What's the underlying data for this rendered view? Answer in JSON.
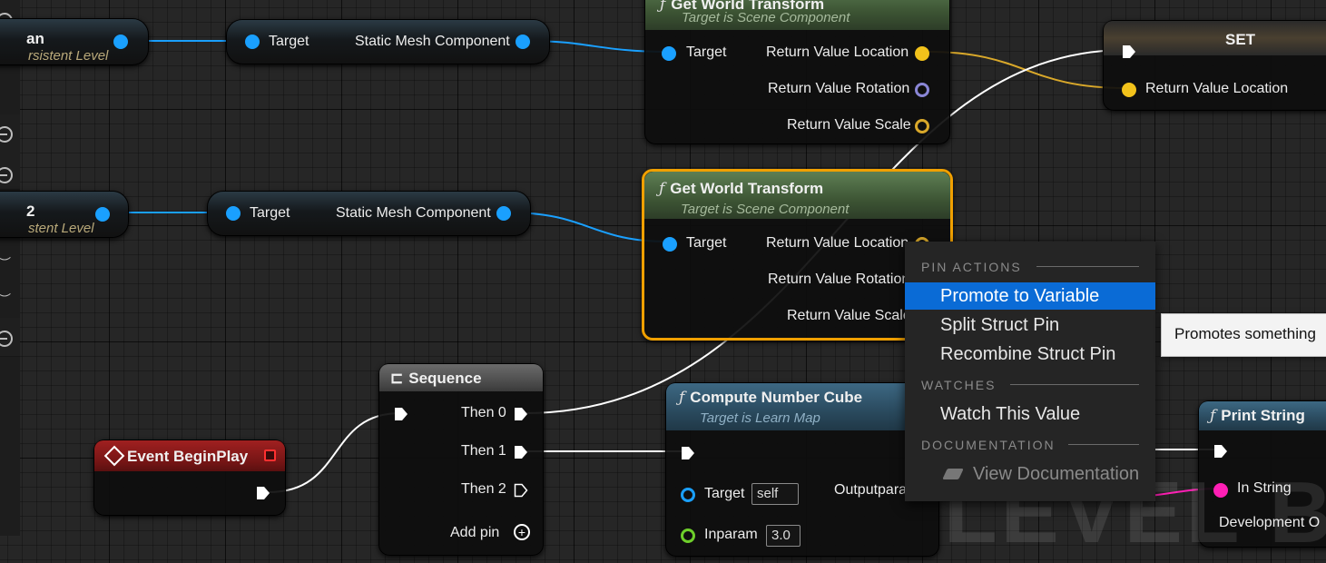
{
  "nodes": {
    "ref1": {
      "title_tail": "an",
      "sub_tail": "rsistent Level"
    },
    "ref2": {
      "title_tail": "2",
      "sub_tail": "stent Level"
    },
    "getter1": {
      "target": "Target",
      "output": "Static Mesh Component"
    },
    "getter2": {
      "target": "Target",
      "output": "Static Mesh Component"
    },
    "transform_top": {
      "title": "Get World Transform",
      "subtitle": "Target is Scene Component",
      "target": "Target",
      "out_location": "Return Value Location",
      "out_rotation": "Return Value Rotation",
      "out_scale": "Return Value Scale"
    },
    "transform_selected": {
      "title": "Get World Transform",
      "subtitle": "Target is Scene Component",
      "target": "Target",
      "out_location": "Return Value Location",
      "out_rotation": "Return Value Rotation",
      "out_scale": "Return Value Scale"
    },
    "set": {
      "title": "SET",
      "in_location": "Return Value Location"
    },
    "sequence": {
      "title": "Sequence",
      "then0": "Then 0",
      "then1": "Then 1",
      "then2": "Then 2",
      "add_pin": "Add pin"
    },
    "event": {
      "title": "Event BeginPlay"
    },
    "compute": {
      "title": "Compute Number Cube",
      "subtitle": "Target is Learn Map",
      "target": "Target",
      "target_value": "self",
      "output": "Outputpara",
      "inparam": "Inparam",
      "inparam_value": "3.0"
    },
    "print": {
      "title": "Print String",
      "in_string": "In String",
      "dev": "Development O"
    }
  },
  "context_menu": {
    "sections": {
      "pin_actions": "PIN ACTIONS",
      "watches": "WATCHES",
      "documentation": "DOCUMENTATION"
    },
    "items": {
      "promote": "Promote to Variable",
      "split": "Split Struct Pin",
      "recombine": "Recombine Struct Pin",
      "watch": "Watch This Value",
      "view_doc": "View Documentation"
    },
    "selected": "Promote to Variable"
  },
  "tooltip": {
    "text": "Promotes something"
  },
  "watermark": "LEVEL BLUE",
  "colors": {
    "object_pin": "#1aa0ff",
    "vector_pin": "#f2c21b",
    "rotator_pin": "#8a86d6",
    "string_pin": "#ff1fb5",
    "selection_outline": "#f0a000",
    "menu_highlight": "#0a6bd6"
  }
}
